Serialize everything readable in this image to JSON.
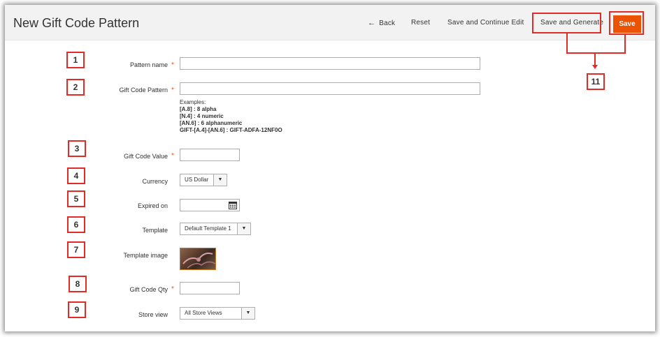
{
  "header": {
    "title": "New Gift Code Pattern",
    "back_label": "Back",
    "reset_label": "Reset",
    "save_continue_label": "Save and Continue Edit",
    "save_generate_label": "Save and Generate",
    "save_label": "Save"
  },
  "callouts": [
    "1",
    "2",
    "3",
    "4",
    "5",
    "6",
    "7",
    "8",
    "9",
    "11"
  ],
  "form": {
    "pattern_name_label": "Pattern name",
    "gift_code_pattern_label": "Gift Code Pattern",
    "examples_heading": "Examples:",
    "examples": [
      {
        "code": "[A.8]",
        "desc": " : 8 alpha"
      },
      {
        "code": "[N.4]",
        "desc": " : 4 numeric"
      },
      {
        "code": "[AN.6]",
        "desc": " : 6 alphanumeric"
      },
      {
        "code": "GIFT-[A.4]-[AN.6]",
        "desc": " : GIFT-ADFA-12NF0O"
      }
    ],
    "gift_code_value_label": "Gift Code Value",
    "currency_label": "Currency",
    "currency_value": "US Dollar",
    "expired_on_label": "Expired on",
    "template_label": "Template",
    "template_value": "Default Template 1",
    "template_image_label": "Template image",
    "gift_code_qty_label": "Gift Code Qty",
    "store_view_label": "Store view",
    "store_view_value": "All Store Views",
    "required_mark": "*"
  },
  "colors": {
    "accent": "#eb5202",
    "annotation": "#e02b27"
  }
}
